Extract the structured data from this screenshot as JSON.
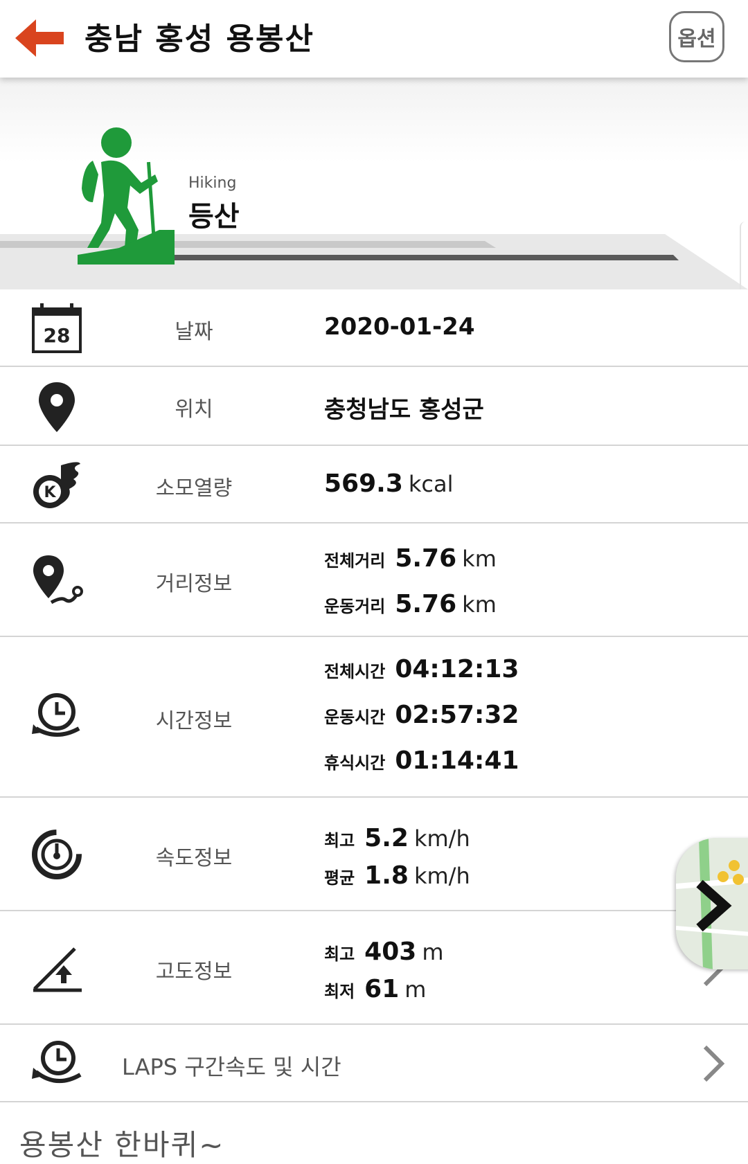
{
  "header": {
    "title": "충남 홍성 용봉산",
    "options_label": "옵션"
  },
  "activity": {
    "type_en": "Hiking",
    "type_ko": "등산",
    "accent_color": "#1f9a3a"
  },
  "rows": {
    "date": {
      "label": "날짜",
      "value": "2020-01-24",
      "icon_day": "28"
    },
    "location": {
      "label": "위치",
      "value": "충청남도 홍성군"
    },
    "calories": {
      "label": "소모열량",
      "value": "569.3",
      "unit": "kcal",
      "icon_letter": "K"
    },
    "distance": {
      "label": "거리정보",
      "total_label": "전체거리",
      "total_value": "5.76",
      "total_unit": "km",
      "moving_label": "운동거리",
      "moving_value": "5.76",
      "moving_unit": "km"
    },
    "time": {
      "label": "시간정보",
      "total_label": "전체시간",
      "total_value": "04:12:13",
      "moving_label": "운동시간",
      "moving_value": "02:57:32",
      "rest_label": "휴식시간",
      "rest_value": "01:14:41"
    },
    "speed": {
      "label": "속도정보",
      "max_label": "최고",
      "max_value": "5.2",
      "max_unit": "km/h",
      "avg_label": "평균",
      "avg_value": "1.8",
      "avg_unit": "km/h"
    },
    "altitude": {
      "label": "고도정보",
      "max_label": "최고",
      "max_value": "403",
      "max_unit": "m",
      "min_label": "최저",
      "min_value": "61",
      "min_unit": "m"
    },
    "laps": {
      "label": "LAPS 구간속도 및 시간"
    }
  },
  "memo": "용봉산 한바퀴~",
  "colors": {
    "back_arrow": "#d9441e",
    "divider": "#d4d4d4",
    "label_gray": "#555555"
  }
}
